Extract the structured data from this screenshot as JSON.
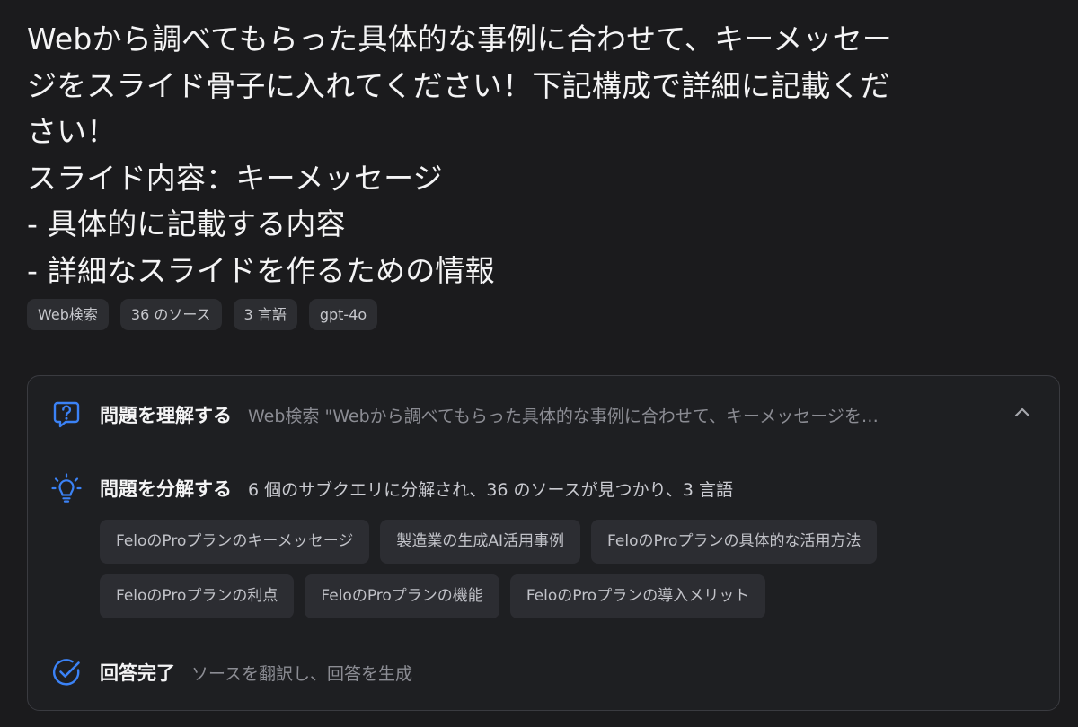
{
  "query": {
    "lines": [
      "Webから調べてもらった具体的な事例に合わせて、キーメッセー",
      "ジをスライド骨子に入れてください！下記構成で詳細に記載くだ",
      "さい！",
      "スライド内容：キーメッセージ",
      "- 具体的に記載する内容",
      "- 詳細なスライドを作るための情報"
    ]
  },
  "meta_tags": [
    "Web検索",
    "36 のソース",
    "3 言語",
    "gpt-4o"
  ],
  "steps": {
    "understand": {
      "icon": "question-bubble-icon",
      "title": "問題を理解する",
      "desc": "Web検索 \"Webから調べてもらった具体的な事例に合わせて、キーメッセージを…"
    },
    "decompose": {
      "icon": "lightbulb-icon",
      "title": "問題を分解する",
      "desc": "6 個のサブクエリに分解され、36 のソースが見つかり、3 言語"
    },
    "complete": {
      "icon": "check-circle-icon",
      "title": "回答完了",
      "desc": "ソースを翻訳し、回答を生成"
    }
  },
  "subqueries": [
    "FeloのProプランのキーメッセージ",
    "製造業の生成AI活用事例",
    "FeloのProプランの具体的な活用方法",
    "FeloのProプランの利点",
    "FeloのProプランの機能",
    "FeloのProプランの導入メリット"
  ],
  "colors": {
    "accent": "#3b82f6",
    "background": "#1b1b1d",
    "panel": "#1e1f22",
    "chip": "#2c2d32"
  }
}
